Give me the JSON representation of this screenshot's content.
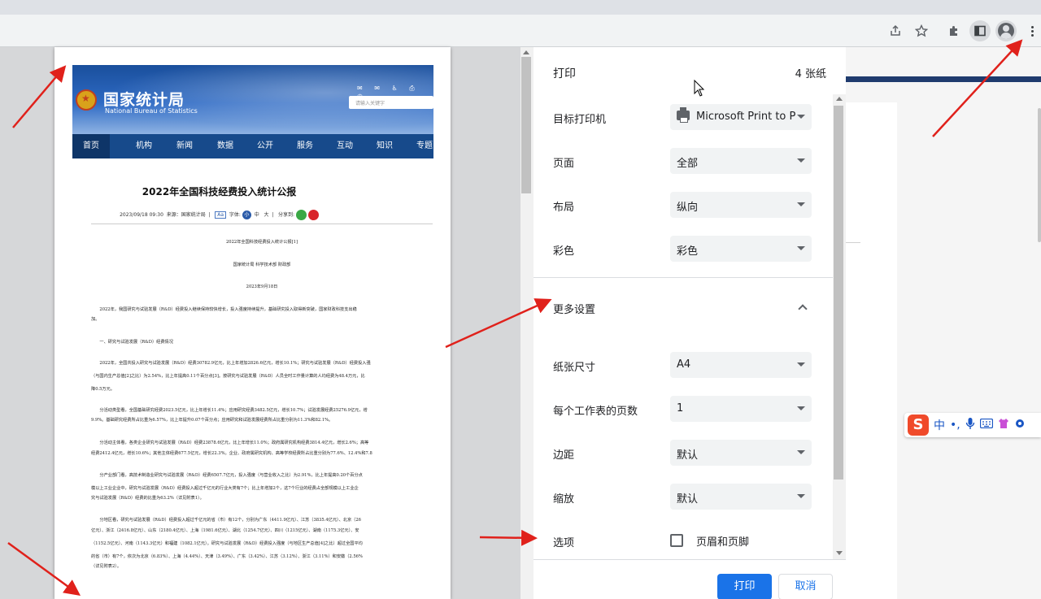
{
  "browser": {
    "toolbar_icons": [
      "share-icon",
      "star-icon",
      "extensions-icon",
      "side-panel-icon",
      "profile-icon",
      "menu-icon"
    ]
  },
  "preview": {
    "site": {
      "title": "国家统计局",
      "subtitle": "National Bureau of Statistics",
      "search_placeholder": "请输入关键字",
      "nav": [
        "首页",
        "机构",
        "新闻",
        "数据",
        "公开",
        "服务",
        "互动",
        "知识",
        "专题"
      ],
      "active_nav": "数据"
    },
    "article": {
      "title": "2022年全国科技经费投入统计公报",
      "meta_date": "2023/09/18 09:30",
      "meta_source": "来源：国家统计局",
      "meta_font_label": "字体:",
      "meta_font_small": "小",
      "meta_font_medium": "中",
      "meta_font_large": "大",
      "meta_share": "分享到:",
      "meta_aa": "Aa",
      "doc_heading": "2022年全国科技经费投入统计公报[1]",
      "doc_authors": "国家统计局   科学技术部   财政部",
      "doc_date": "2023年9月18日",
      "paragraphs": [
        "2022年，我国研究与试验发展（R&D）经费投入继续保持较快增长，投入强度持续提升，基础研究投入取得新突破，国家财政科技支出稳",
        "加。",
        "一、研究与试验发展（R&D）经费情况",
        "2022年，全国共投入研究与试验发展（R&D）经费30782.9亿元，比上年增加2826.6亿元，增长10.1%；研究与试验发展（R&D）经费投入强",
        "（与国内生产总值[2]之比）为2.54%，比上年提高0.11个百分点[3]。按研究与试验发展（R&D）人员全时工作量计算的人均经费为48.4万元，比",
        "降0.5万元。",
        "分活动类型看，全国基础研究经费2023.5亿元，比上年增长11.4%；应用研究经费3482.5亿元，增长10.7%；试验发展经费25276.9亿元，增",
        "9.9%。基础研究经费所占比重为6.57%，比上年提升0.07个百分点；应用研究和试验发展经费所占比重分别为11.3%和82.1%。",
        "分活动主体看，各类企业研究与试验发展（R&D）经费23878.6亿元，比上年增长11.0%；政府属研究机构经费3814.4亿元，增长2.6%；高等",
        "经费2412.4亿元，增长10.6%；其他主体经费677.5亿元，增长22.3%。企业、政府属研究机构、高等学校经费所占比重分别为77.6%、12.4%和7.8",
        "分产业部门看，高技术制造业研究与试验发展（R&D）经费6507.7亿元，投入强度（与营业收入之比）为2.91%，比上年提高0.20个百分点",
        "模以上工业企业中，研究与试验发展（R&D）经费投入超过千亿元的行业大类有7个；比上年增加2个，这7个行业的经费占全部规模以上工业企",
        "究与试验发展（R&D）经费的比重为63.2%（详见附表1）。",
        "分地区看，研究与试验发展（R&D）经费投入超过千亿元的省（市）有12个，分别为广东（4411.9亿元）、江苏（3835.4亿元）、北京（26",
        "亿元）、浙江（2416.8亿元）、山东（2180.4亿元）、上海（1981.6亿元）、湖北（1254.7亿元）、四川（1215亿元）、湖南（1175.3亿元）、安",
        "（1152.5亿元）、河南（1143.3亿元）和福建（1082.1亿元）。研究与试验发展（R&D）经费投入强度（与地区生产总值[4]之比）超过全国平均",
        "的省（市）有7个，依次为北京（6.83%）、上海（4.44%）、天津（3.49%）、广东（3.42%）、江苏（3.12%）、浙江（3.11%）和安徽（2.56%",
        "（详见附表2）。"
      ]
    }
  },
  "print_panel": {
    "title": "打印",
    "sheet_count": "4 张纸",
    "rows": [
      {
        "label": "目标打印机",
        "value": "Microsoft Print to P",
        "icon": "printer-icon"
      },
      {
        "label": "页面",
        "value": "全部"
      },
      {
        "label": "布局",
        "value": "纵向"
      },
      {
        "label": "彩色",
        "value": "彩色"
      }
    ],
    "more_settings_label": "更多设置",
    "more_rows": [
      {
        "label": "纸张尺寸",
        "value": "A4"
      },
      {
        "label": "每个工作表的页数",
        "value": "1"
      },
      {
        "label": "边距",
        "value": "默认"
      },
      {
        "label": "缩放",
        "value": "默认"
      }
    ],
    "options_label": "选项",
    "checkbox_label": "页眉和页脚",
    "checkbox_checked": false,
    "print_button": "打印",
    "cancel_button": "取消",
    "accent_color": "#1a73e8"
  },
  "ime": {
    "logo": "S",
    "items": [
      "中",
      "•,",
      "🎤",
      "⌨",
      "👕",
      "⚙"
    ]
  },
  "annotation_color": "#e0211b"
}
